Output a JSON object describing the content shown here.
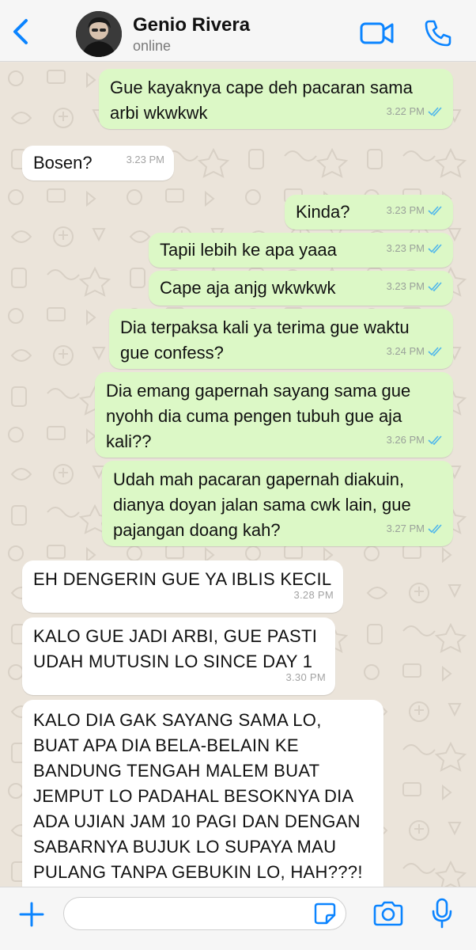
{
  "header": {
    "back_icon": "chevron-left-icon",
    "contact_name": "Genio Rivera",
    "status": "online",
    "video_icon": "video-camera-icon",
    "call_icon": "phone-icon",
    "accent_color": "#0b84ff"
  },
  "messages": [
    {
      "direction": "out",
      "text": "Gue kayaknya cape deh pacaran sama\narbi wkwkwk",
      "time": "3.22 PM",
      "read": true
    },
    {
      "direction": "in",
      "text": "Bosen?",
      "time": "3.23 PM"
    },
    {
      "direction": "out",
      "text": "Kinda?",
      "time": "3.23 PM",
      "read": true
    },
    {
      "direction": "out",
      "text": "Tapii lebih ke apa yaaa",
      "time": "3.23 PM",
      "read": true
    },
    {
      "direction": "out",
      "text": "Cape aja anjg wkwkwk",
      "time": "3.23 PM",
      "read": true
    },
    {
      "direction": "out",
      "text": "Dia terpaksa kali ya terima gue waktu\ngue confess?",
      "time": "3.24 PM",
      "read": true
    },
    {
      "direction": "out",
      "text": "Dia emang gapernah sayang sama gue\nnyohh dia cuma pengen tubuh gue aja\nkali??",
      "time": "3.26 PM",
      "read": true
    },
    {
      "direction": "out",
      "text": "Udah mah pacaran gapernah diakuin,\ndianya doyan jalan sama cwk lain, gue\npajangan doang kah?",
      "time": "3.27 PM",
      "read": true
    },
    {
      "direction": "in",
      "text": "EH DENGERIN GUE YA IBLIS KECIL",
      "time": "3.28 PM"
    },
    {
      "direction": "in",
      "text": "KALO GUE JADI ARBI, GUE PASTI\nUDAH MUTUSIN LO SINCE DAY 1",
      "time": "3.30 PM"
    },
    {
      "direction": "in",
      "text": "KALO DIA GAK SAYANG SAMA LO,\nBUAT APA DIA BELA-BELAIN KE\nBANDUNG TENGAH MALEM BUAT\nJEMPUT LO PADAHAL BESOKNYA DIA\nADA UJIAN JAM 10 PAGI DAN DENGAN\nSABARNYA BUJUK LO SUPAYA MAU\nPULANG TANPA GEBUKIN LO, HAH???!",
      "time": ""
    }
  ],
  "input_bar": {
    "plus_icon": "plus-icon",
    "input_value": "",
    "sticker_icon": "sticker-icon",
    "camera_icon": "camera-icon",
    "mic_icon": "microphone-icon"
  },
  "colors": {
    "outgoing_bubble": "#dcf8c6",
    "incoming_bubble": "#ffffff",
    "chat_background": "#ece5dd",
    "read_ticks": "#4fb6ec"
  }
}
